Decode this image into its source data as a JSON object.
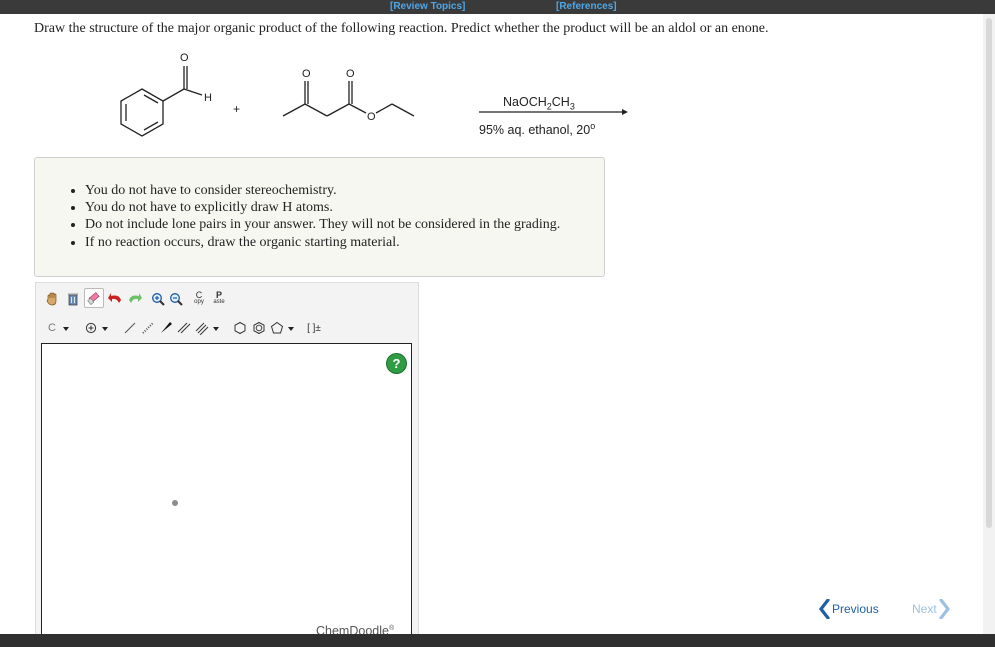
{
  "header": {
    "review_topics": "[Review Topics]",
    "references": "[References]"
  },
  "question": {
    "text": "Draw the structure of the major organic product of the following reaction. Predict whether the product will be an aldol or an enone."
  },
  "reaction": {
    "plus": "+",
    "reagent_above": "NaOCH₂CH₃",
    "reagent_above_base": "NaOCH",
    "reagent_above_sub1": "2",
    "reagent_above_mid": "CH",
    "reagent_above_sub2": "3",
    "conditions_below": "95% aq. ethanol, 20",
    "conditions_degree": "o",
    "atom_labels": {
      "o1": "O",
      "h1": "H",
      "o2": "O",
      "o3": "O",
      "o4": "O"
    }
  },
  "notes": {
    "items": [
      "You do not have to consider stereochemistry.",
      "You do not have to explicitly draw H atoms.",
      "Do not include lone pairs in your answer. They will not be considered in the grading.",
      "If no reaction occurs, draw the organic starting material."
    ]
  },
  "editor": {
    "copy_label_1": "C",
    "copy_label_2": "opy",
    "paste_label_1": "P",
    "paste_label_2": "aste",
    "element_label": "C",
    "bracket_label": "[ ]±",
    "help_label": "?",
    "brand": "ChemDoodle",
    "brand_mark": "®",
    "icons": [
      "hand-icon",
      "trash-icon",
      "eraser-icon",
      "undo-icon",
      "redo-icon",
      "zoom-in-icon",
      "zoom-out-icon",
      "copy-icon",
      "paste-icon",
      "element-icon",
      "charge-icon",
      "single-bond-icon",
      "hashed-bond-icon",
      "wedge-bond-icon",
      "double-bond-icon",
      "triple-bond-icon",
      "benzene-icon",
      "cyclohexane-icon",
      "cyclopentane-icon",
      "bracket-icon"
    ]
  },
  "navigation": {
    "previous": "Previous",
    "next": "Next"
  }
}
